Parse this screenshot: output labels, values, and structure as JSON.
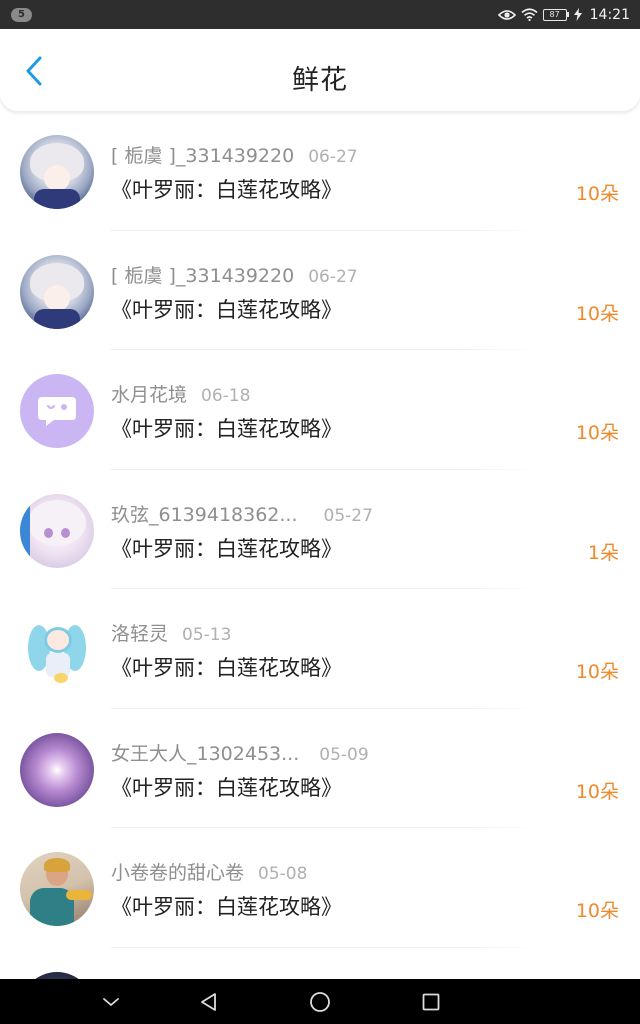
{
  "status_bar": {
    "notification_count": "5",
    "battery_level": "87",
    "time": "14:21",
    "icons": [
      "eye-comfort-icon",
      "wifi-icon",
      "battery-icon",
      "charging-icon"
    ]
  },
  "header": {
    "title": "鲜花",
    "back_icon": "chevron-left-icon",
    "accent_color": "#1e9be8"
  },
  "colors": {
    "flower_count": "#ef8a2c",
    "username": "#8f8f8f",
    "date": "#b0b0b0"
  },
  "gifts": [
    {
      "user": "[ 栀虞 ]_331439220",
      "date": "06-27",
      "book": "《叶罗丽：白莲花攻略》",
      "count": "10朵",
      "avatar": "anime-girl-avatar"
    },
    {
      "user": "[ 栀虞 ]_331439220",
      "date": "06-27",
      "book": "《叶罗丽：白莲花攻略》",
      "count": "10朵",
      "avatar": "anime-girl-avatar"
    },
    {
      "user": "水月花境",
      "date": "06-18",
      "book": "《叶罗丽：白莲花攻略》",
      "count": "10朵",
      "avatar": "default-chat-avatar"
    },
    {
      "user": "玖弦_6139418362...",
      "date": "05-27",
      "book": "《叶罗丽：白莲花攻略》",
      "count": "1朵",
      "avatar": "anime-girl-avatar"
    },
    {
      "user": "洛轻灵",
      "date": "05-13",
      "book": "《叶罗丽：白莲花攻略》",
      "count": "10朵",
      "avatar": "chibi-avatar"
    },
    {
      "user": "女王大人_1302453...",
      "date": "05-09",
      "book": "《叶罗丽：白莲花攻略》",
      "count": "10朵",
      "avatar": "galaxy-avatar"
    },
    {
      "user": "小卷卷的甜心卷",
      "date": "05-08",
      "book": "《叶罗丽：白莲花攻略》",
      "count": "10朵",
      "avatar": "photo-avatar"
    }
  ],
  "nav_bar": {
    "buttons": [
      "chevron-down-icon",
      "back-triangle-icon",
      "home-circle-icon",
      "recents-square-icon"
    ]
  }
}
